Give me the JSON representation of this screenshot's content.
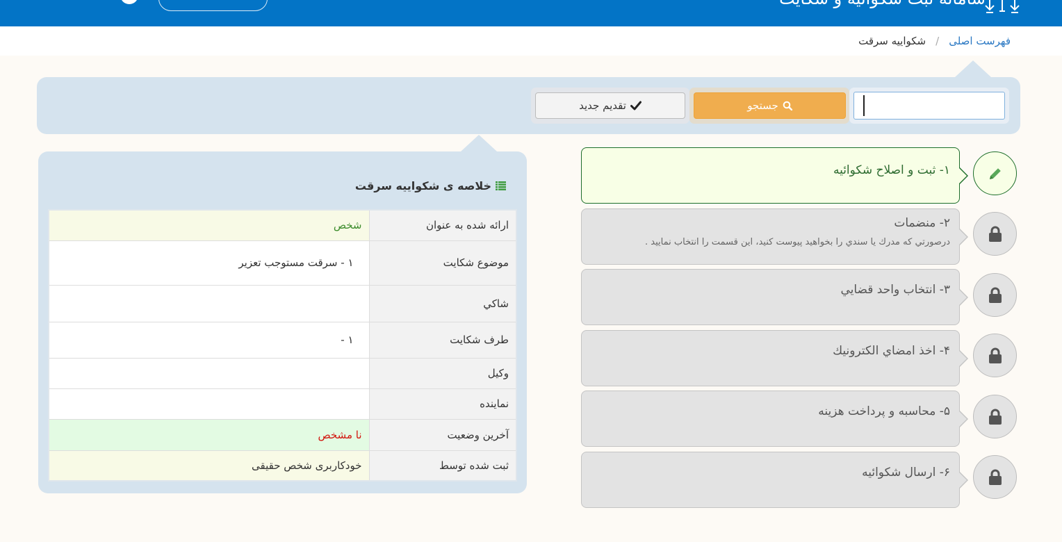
{
  "header": {
    "title": "سامانه ثبت شکوائیه و شکایت",
    "colors": {
      "header_bg": "#0374c6",
      "accent_orange": "#f0ad4e",
      "panel_bg": "#d5e3ee"
    }
  },
  "breadcrumb": {
    "home": "فهرست اصلی",
    "separator": "/",
    "current": "شکواییه سرقت"
  },
  "search": {
    "input_value": "",
    "button_label": "جستجو",
    "button_icon": "search-icon",
    "new_label": "تقدیم جدید",
    "new_icon": "check-icon"
  },
  "summary": {
    "title": "خلاصه ی شکواییه سرقت",
    "title_icon": "list-icon",
    "rows": [
      {
        "label": "ارائه شده به عنوان",
        "value": "شخص"
      },
      {
        "label": "موضوع شكايت",
        "value": "۱ - سرقت مستوجب تعزیر"
      },
      {
        "label": "شاكي",
        "value": ""
      },
      {
        "label": "طرف شكايت",
        "value": "۱ -"
      },
      {
        "label": "وكيل",
        "value": ""
      },
      {
        "label": "نماينده",
        "value": ""
      },
      {
        "label": "آخرین وضعیت",
        "value": "نا مشخص"
      },
      {
        "label": "ثبت شده توسط",
        "value": "خودکاربری شخص حقیقی"
      }
    ]
  },
  "steps": [
    {
      "title": "۱- ثبت و اصلاح شکوائیه",
      "desc": "",
      "icon": "pencil-icon",
      "active": true
    },
    {
      "title": "۲- منضمات",
      "desc": "درصورتي كه مدرك يا سندي را بخواهيد پيوست كنيد، اين قسمت را انتخاب نماييد .",
      "icon": "lock-icon",
      "active": false
    },
    {
      "title": "۳- انتخاب واحد قضايي",
      "desc": "",
      "icon": "lock-icon",
      "active": false
    },
    {
      "title": "۴- اخذ امضاي الكترونيك",
      "desc": "",
      "icon": "lock-icon",
      "active": false
    },
    {
      "title": "۵- محاسبه و پرداخت هزینه",
      "desc": "",
      "icon": "lock-icon",
      "active": false
    },
    {
      "title": "۶- ارسال شکوائیه",
      "desc": "",
      "icon": "lock-icon",
      "active": false
    }
  ]
}
